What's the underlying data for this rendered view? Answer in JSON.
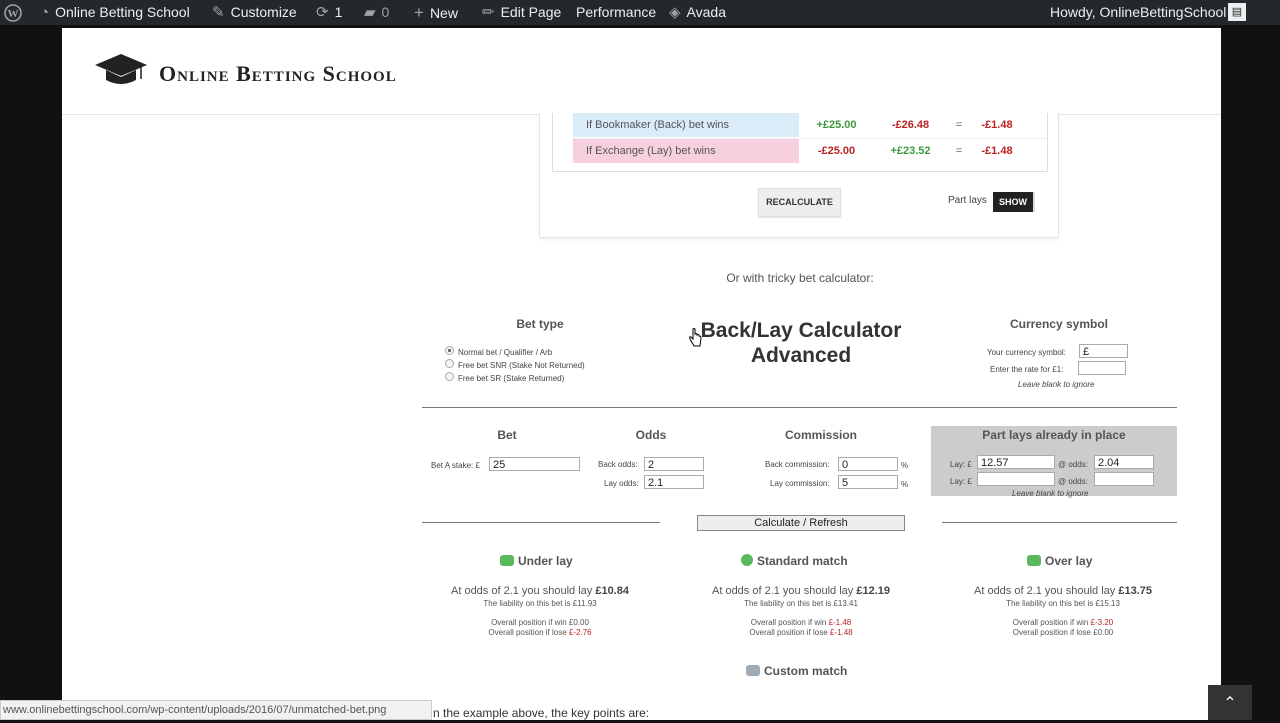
{
  "adminbar": {
    "site_name": "Online Betting School",
    "customize": "Customize",
    "updates": "1",
    "comments": "0",
    "new": "New",
    "edit_page": "Edit Page",
    "performance": "Performance",
    "avada": "Avada",
    "howdy": "Howdy, OnlineBettingSchool"
  },
  "header": {
    "logo_text": "Online Betting School"
  },
  "calc1": {
    "rows": [
      {
        "label": "If Bookmaker (Back) bet wins",
        "v1": "+£25.00",
        "v2": "-£26.48",
        "eq": "=",
        "v3": "-£1.48"
      },
      {
        "label": "If Exchange (Lay) bet wins",
        "v1": "-£25.00",
        "v2": "+£23.52",
        "eq": "=",
        "v3": "-£1.48"
      }
    ],
    "recalculate": "RECALCULATE",
    "part_lays": "Part lays",
    "show": "SHOW"
  },
  "tricky_text": "Or with tricky bet calculator:",
  "advanced": {
    "title_line1": "Back/Lay Calculator",
    "title_line2": "Advanced",
    "bet_type_heading": "Bet type",
    "bet_types": [
      "Normal bet / Qualifier / Arb",
      "Free bet SNR (Stake Not Returned)",
      "Free bet SR (Stake Returned)"
    ],
    "currency_heading": "Currency symbol",
    "currency_label": "Your currency symbol:",
    "currency_value": "£",
    "rate_label": "Enter the rate for £1:",
    "rate_value": "",
    "leave_blank": "Leave blank to ignore",
    "bet_heading": "Bet",
    "odds_heading": "Odds",
    "commission_heading": "Commission",
    "partlays_heading": "Part lays already in place",
    "bet_a_label": "Bet A stake: £",
    "bet_a_value": "25",
    "back_odds_label": "Back odds:",
    "back_odds_value": "2",
    "lay_odds_label": "Lay odds:",
    "lay_odds_value": "2.1",
    "back_comm_label": "Back commission:",
    "back_comm_value": "0",
    "lay_comm_label": "Lay commission:",
    "lay_comm_value": "5",
    "percent": "%",
    "lay_label": "Lay: £",
    "at_odds_label": "@ odds:",
    "lay1_value": "12.57",
    "odds1_value": "2.04",
    "lay2_value": "",
    "odds2_value": "",
    "partlays_leave_blank": "Leave blank to ignore",
    "calculate_button": "Calculate / Refresh"
  },
  "results": [
    {
      "title": "Under lay",
      "main_prefix": "At odds of 2.1 you should lay",
      "amount": "£10.84",
      "liability": "The liability on this bet is £11.93",
      "win_label": "Overall position if win",
      "win_value": "£0.00",
      "lose_label": "Overall position if lose",
      "lose_value": "£-2.76"
    },
    {
      "title": "Standard match",
      "main_prefix": "At odds of 2.1 you should lay",
      "amount": "£12.19",
      "liability": "The liability on this bet is £13.41",
      "win_label": "Overall position if win",
      "win_value": "£-1.48",
      "lose_label": "Overall position if lose",
      "lose_value": "£-1.48"
    },
    {
      "title": "Over lay",
      "main_prefix": "At odds of 2.1 you should lay",
      "amount": "£13.75",
      "liability": "The liability on this bet is £15.13",
      "win_label": "Overall position if win",
      "win_value": "£-3.20",
      "lose_label": "Overall position if lose",
      "lose_value": "£0.00"
    }
  ],
  "custom_match": "Custom match",
  "status_url": "www.onlinebettingschool.com/wp-content/uploads/2016/07/unmatched-bet.png",
  "key_points": "n the example above, the key points are:",
  "colors": {
    "adminbar": "#23282d",
    "back_row": "#d9ecf8",
    "lay_row": "#f7d0e0",
    "partlays_box": "#cccccc",
    "negative": "#bb2222",
    "positive": "#3a9a3a"
  }
}
